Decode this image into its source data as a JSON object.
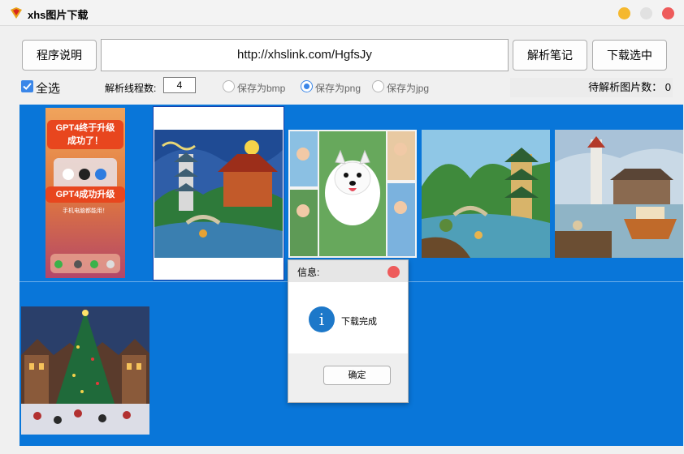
{
  "window": {
    "title": "xhs图片下载"
  },
  "toolbar": {
    "help_label": "程序说明",
    "url_value": "http://xhslink.com/HgfsJy",
    "parse_label": "解析笔记",
    "download_label": "下载选中"
  },
  "options": {
    "select_all_label": "全选",
    "select_all_checked": true,
    "threads_label": "解析线程数:",
    "threads_value": "4",
    "formats": [
      {
        "label": "保存为bmp",
        "checked": false
      },
      {
        "label": "保存为png",
        "checked": true
      },
      {
        "label": "保存为jpg",
        "checked": false
      }
    ],
    "pending_text": "待解析图片数： 0"
  },
  "thumbnails": [
    {
      "name": "gpt4-upgrade-poster",
      "lines": [
        "GPT4终于升级",
        "成功了！",
        "GPT4成功升级",
        "手机电脑都能用！"
      ],
      "icon": "phone-screenshot-icon"
    },
    {
      "name": "starry-night-pagoda",
      "selected": true
    },
    {
      "name": "pomeranian-comic"
    },
    {
      "name": "pagoda-landscape"
    },
    {
      "name": "lighthouse-harbor"
    },
    {
      "name": "christmas-village"
    }
  ],
  "dialog": {
    "title": "信息:",
    "message": "下载完成",
    "ok_label": "确定",
    "icon": "info-icon"
  },
  "colors": {
    "gallery_bg": "#0976d9",
    "accent": "#3a86e8",
    "close": "#ee5b5b",
    "minimize": "#f5b82e"
  }
}
